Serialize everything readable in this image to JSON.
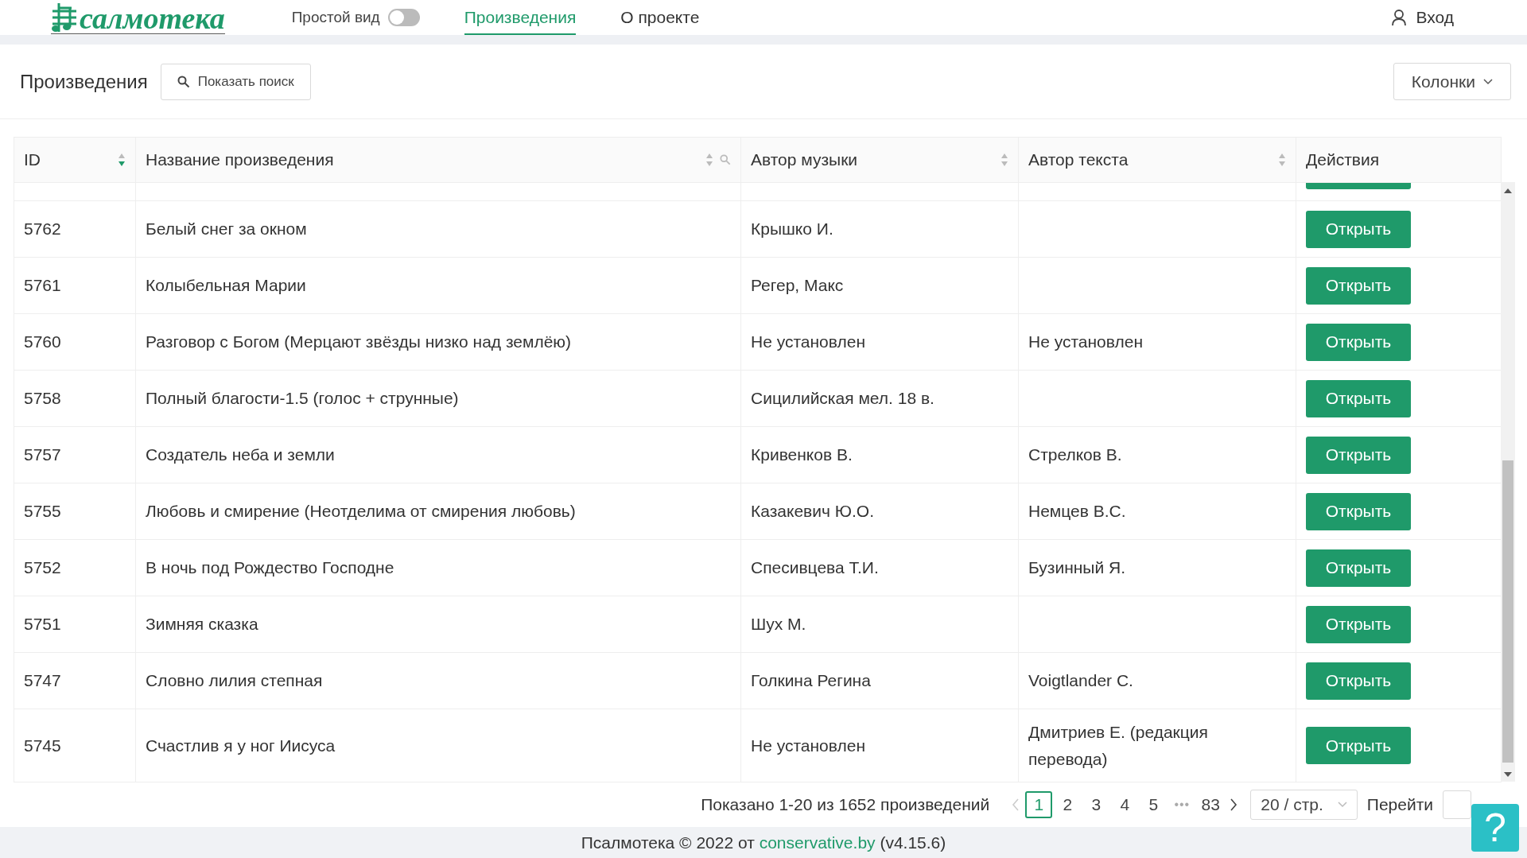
{
  "header": {
    "logo": "салмотека",
    "simple_view": {
      "label": "Простой вид",
      "on": false
    },
    "nav": [
      {
        "label": "Произведения",
        "selected": true
      },
      {
        "label": "О проекте",
        "selected": false
      }
    ],
    "login": "Вход"
  },
  "toolbar": {
    "title": "Произведения",
    "search_button": "Показать поиск",
    "columns_button": "Колонки"
  },
  "table": {
    "columns": [
      {
        "label": "ID",
        "sortable": true,
        "sorted": true,
        "filterable": false
      },
      {
        "label": "Название произведения",
        "sortable": true,
        "sorted": false,
        "filterable": true
      },
      {
        "label": "Автор музыки",
        "sortable": true,
        "sorted": false,
        "filterable": false
      },
      {
        "label": "Автор текста",
        "sortable": true,
        "sorted": false,
        "filterable": false
      },
      {
        "label": "Действия",
        "sortable": false,
        "filterable": false
      }
    ],
    "rows": [
      {
        "id": "5762",
        "title": "Белый снег за окном",
        "music": "Крышко И.",
        "action": "Открыть"
      },
      {
        "id": "5761",
        "title": "Колыбельная Марии",
        "music": "Регер, Макс",
        "action": "Открыть"
      },
      {
        "id": "5760",
        "title": "Разговор с Богом (Мерцают звёзды низко над землёю)",
        "music": "Не установлен",
        "text": "Не установлен",
        "action": "Открыть"
      },
      {
        "id": "5758",
        "title": "Полный благости-1.5 (голос + струнные)",
        "music": "Сицилийская мел. 18 в.",
        "action": "Открыть"
      },
      {
        "id": "5757",
        "title": "Создатель неба и земли",
        "music": "Кривенков В.",
        "text": "Стрелков В.",
        "action": "Открыть"
      },
      {
        "id": "5755",
        "title": "Любовь и смирение (Неотделима от смирения любовь)",
        "music": "Казакевич Ю.О.",
        "text": "Немцев В.С.",
        "action": "Открыть"
      },
      {
        "id": "5752",
        "title": "В ночь под Рождество Господне",
        "music": "Спесивцева Т.И.",
        "text": "Бузинный Я.",
        "action": "Открыть"
      },
      {
        "id": "5751",
        "title": "Зимняя сказка",
        "music": "Шух М.",
        "action": "Открыть"
      },
      {
        "id": "5747",
        "title": "Словно лилия степная",
        "music": "Голкина Регина",
        "text": "Voigtlander C.",
        "action": "Открыть"
      },
      {
        "id": "5745",
        "title": "Счастлив я у ног Иисуса",
        "music": "Не установлен",
        "text": "Дмитриев Е. (редакция перевода)",
        "action": "Открыть"
      }
    ]
  },
  "pagination": {
    "summary": "Показано 1-20 из 1652 произведений",
    "prev_disabled": true,
    "pages": [
      {
        "label": "1",
        "selected": true
      },
      {
        "label": "2",
        "selected": false
      },
      {
        "label": "3",
        "selected": false
      },
      {
        "label": "4",
        "selected": false
      },
      {
        "label": "5",
        "selected": false
      },
      {
        "label": "•••",
        "selected": false
      },
      {
        "label": "83",
        "selected": false
      }
    ],
    "page_size": "20 / стр.",
    "jump_label": "Перейти"
  },
  "help_button": "?",
  "footer": {
    "before": "Псалмотека © 2022 от ",
    "link": "conservative.by",
    "after": " (v4.15.6)"
  }
}
